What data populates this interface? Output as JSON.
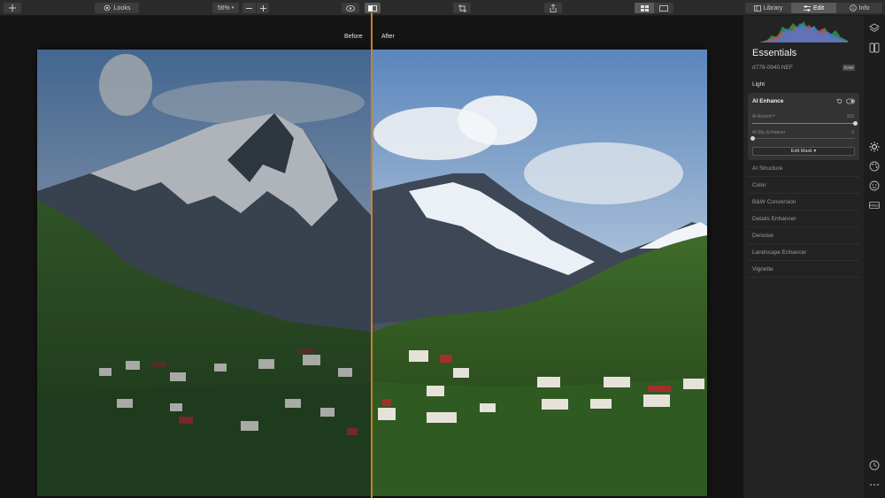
{
  "toolbar": {
    "add_icon": "plus-icon",
    "looks_label": "Looks",
    "zoom_value": "56%",
    "before_after_label_before": "Before",
    "before_after_label_after": "After",
    "library_label": "Library",
    "edit_label": "Edit",
    "info_label": "Info"
  },
  "panel": {
    "title": "Essentials",
    "filename": "d778-0940.NEF",
    "raw_badge": "RAW",
    "section": "Light",
    "ai_enhance": {
      "title": "AI Enhance",
      "accent_label": "AI Accent™",
      "accent_value": "100",
      "accent_level": 1.0,
      "sky_label": "AI Sky Enhancer",
      "sky_value": "0",
      "sky_level": 0.0,
      "mask_button": "Edit Mask ▾"
    },
    "tools": [
      "AI Structure",
      "Color",
      "B&W Conversion",
      "Details Enhancer",
      "Denoise",
      "Landscape Enhancer",
      "Vignette"
    ]
  },
  "colors": {
    "split_line": "#c8812f",
    "slider_fill": "#5b84c4",
    "panel_bg": "#232323"
  }
}
